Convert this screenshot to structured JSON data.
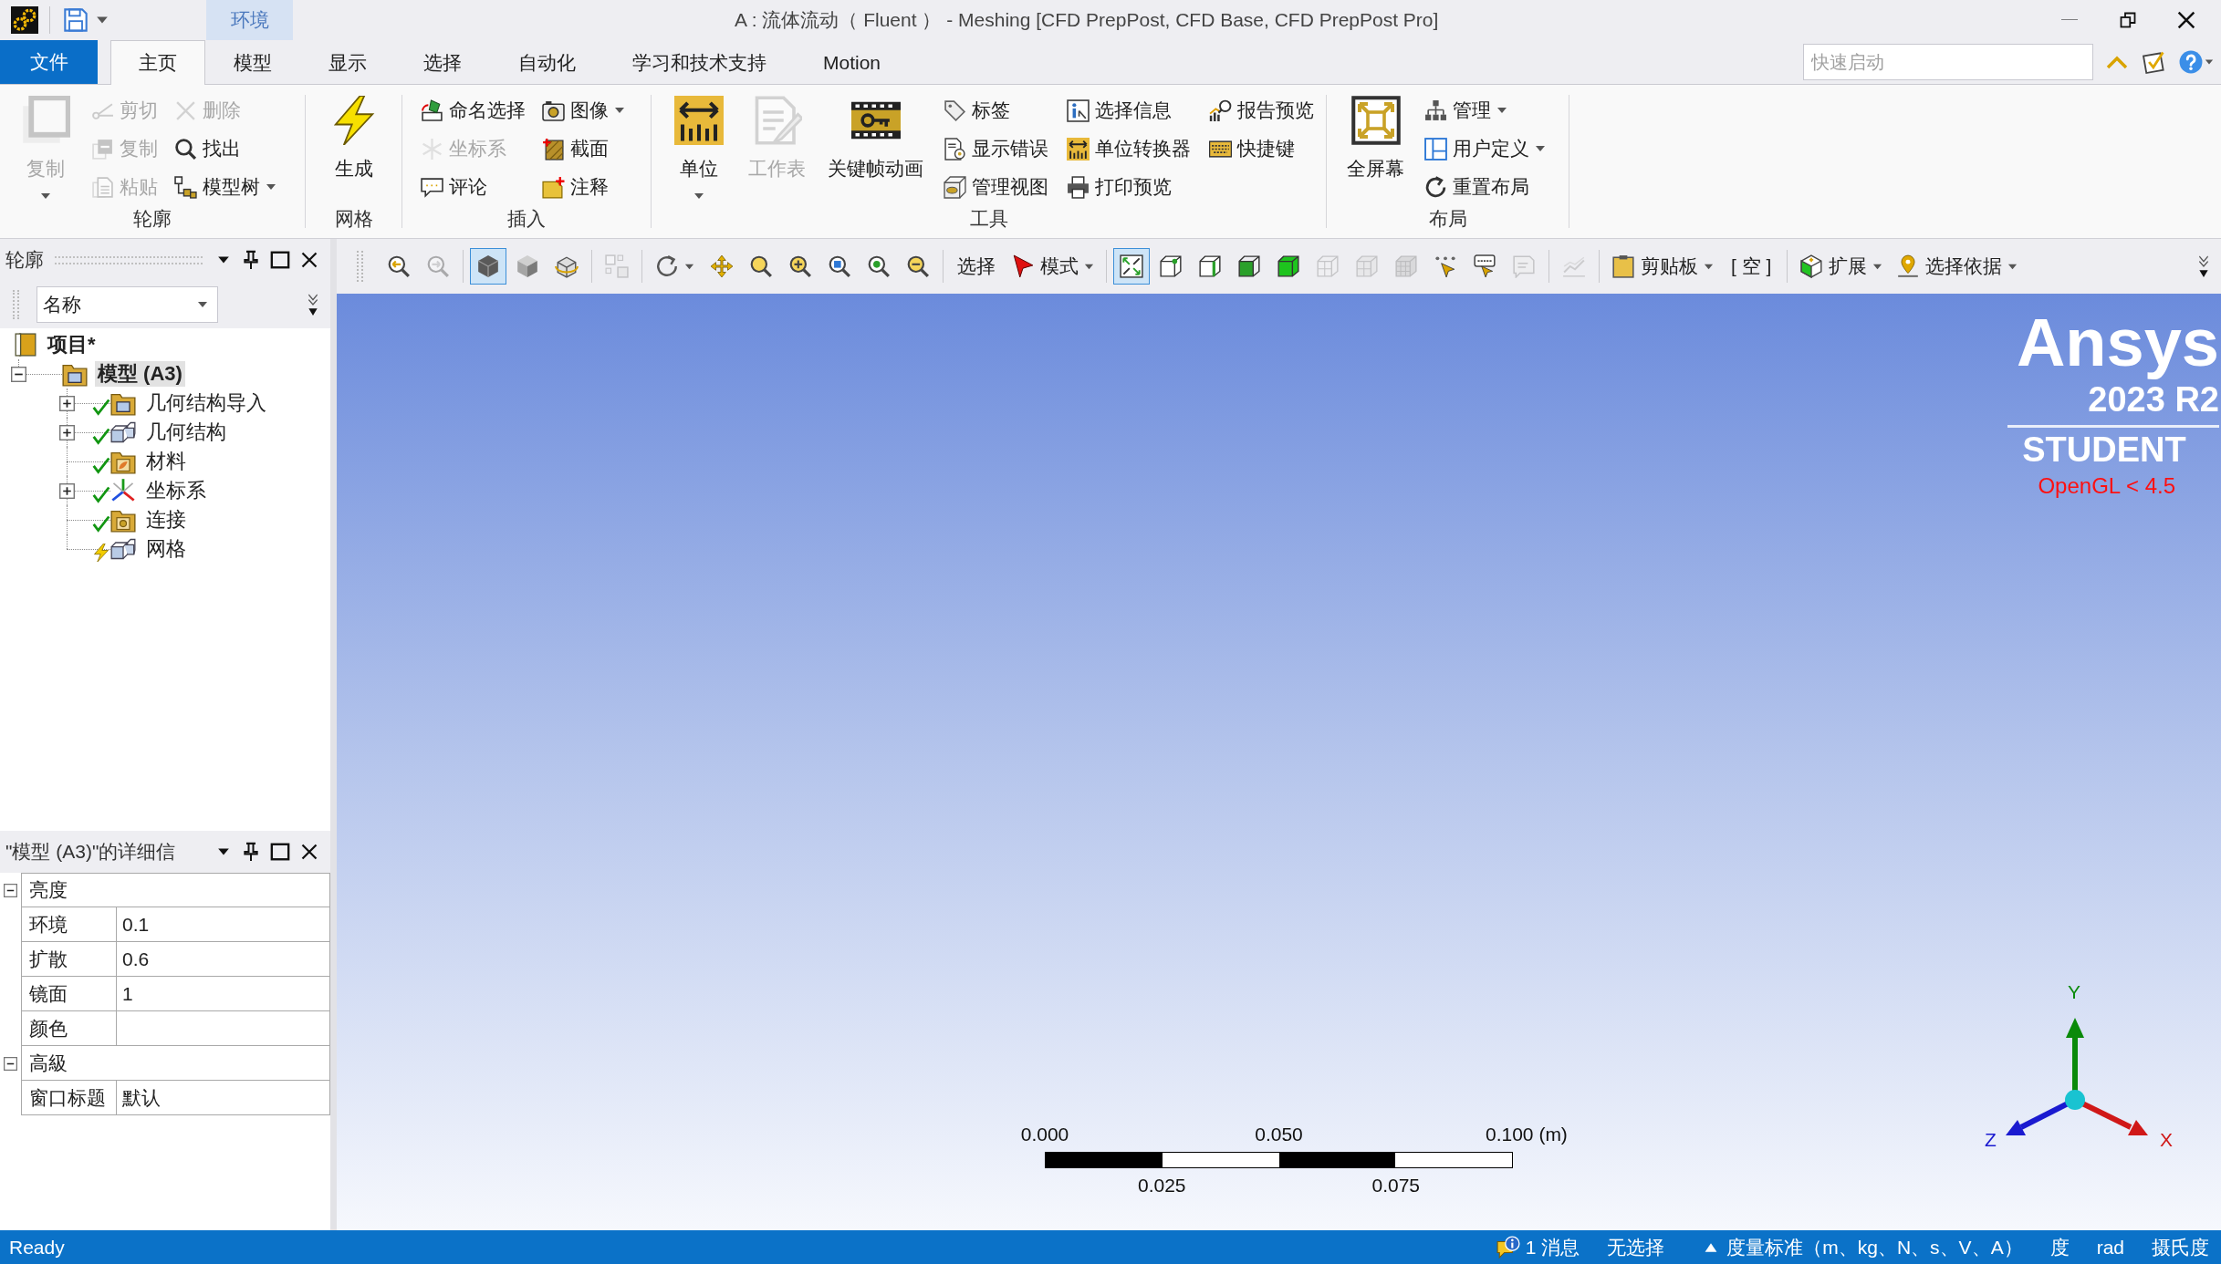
{
  "window": {
    "title": "A : 流体流动（ Fluent ） - Meshing [CFD PrepPost, CFD Base, CFD PrepPost Pro]",
    "context_tab": "环境"
  },
  "menu_tabs": [
    {
      "label": "文件",
      "kind": "file",
      "selected": false
    },
    {
      "label": "主页",
      "kind": "tab",
      "selected": true
    },
    {
      "label": "模型",
      "kind": "tab",
      "selected": false
    },
    {
      "label": "显示",
      "kind": "tab",
      "selected": false
    },
    {
      "label": "选择",
      "kind": "tab",
      "selected": false
    },
    {
      "label": "自动化",
      "kind": "tab",
      "selected": false
    },
    {
      "label": "学习和技术支持",
      "kind": "tab",
      "selected": false
    },
    {
      "label": "Motion",
      "kind": "tab",
      "selected": false
    }
  ],
  "quick_launch": {
    "placeholder": "快速启动"
  },
  "ribbon": [
    {
      "label": "轮廓",
      "columns": [
        {
          "kind": "large",
          "label": "复制",
          "disabled": true,
          "dropdown": true
        },
        {
          "kind": "stack",
          "items": [
            {
              "label": "剪切",
              "disabled": true
            },
            {
              "label": "复制",
              "disabled": true
            },
            {
              "label": "粘贴",
              "disabled": true
            }
          ]
        },
        {
          "kind": "stack",
          "items": [
            {
              "label": "删除",
              "disabled": true
            },
            {
              "label": "找出",
              "disabled": false
            },
            {
              "label": "模型树",
              "disabled": false,
              "dropdown": true
            }
          ]
        }
      ]
    },
    {
      "label": "网格",
      "columns": [
        {
          "kind": "large",
          "label": "生成",
          "disabled": false
        }
      ]
    },
    {
      "label": "插入",
      "columns": [
        {
          "kind": "stack",
          "items": [
            {
              "label": "命名选择",
              "disabled": false
            },
            {
              "label": "坐标系",
              "disabled": true
            },
            {
              "label": "评论",
              "disabled": false
            }
          ]
        },
        {
          "kind": "stack",
          "items": [
            {
              "label": "图像",
              "disabled": false,
              "dropdown": true
            },
            {
              "label": "截面",
              "disabled": false
            },
            {
              "label": "注释",
              "disabled": false
            }
          ]
        }
      ]
    },
    {
      "label": "工具",
      "columns": [
        {
          "kind": "large",
          "label": "单位",
          "disabled": false,
          "dropdown": true
        },
        {
          "kind": "large",
          "label": "工作表",
          "disabled": true
        },
        {
          "kind": "large",
          "label": "关键帧动画",
          "disabled": false
        },
        {
          "kind": "stack",
          "items": [
            {
              "label": "标签",
              "disabled": false
            },
            {
              "label": "显示错误",
              "disabled": false
            },
            {
              "label": "管理视图",
              "disabled": false
            }
          ]
        },
        {
          "kind": "stack",
          "items": [
            {
              "label": "选择信息",
              "disabled": false
            },
            {
              "label": "单位转换器",
              "disabled": false
            },
            {
              "label": "打印预览",
              "disabled": false
            }
          ]
        },
        {
          "kind": "stack",
          "items": [
            {
              "label": "报告预览",
              "disabled": false
            },
            {
              "label": "快捷键",
              "disabled": false
            }
          ]
        }
      ]
    },
    {
      "label": "布局",
      "columns": [
        {
          "kind": "large",
          "label": "全屏幕",
          "disabled": false
        },
        {
          "kind": "stack",
          "items": [
            {
              "label": "管理",
              "disabled": false,
              "dropdown": true
            },
            {
              "label": "用户定义",
              "disabled": false,
              "dropdown": true
            },
            {
              "label": "重置布局",
              "disabled": false
            }
          ]
        }
      ]
    }
  ],
  "toolbar": {
    "groups": [
      [
        {
          "kind": "icon",
          "selected": false,
          "disabled": false
        },
        {
          "kind": "icon",
          "selected": false,
          "disabled": true
        }
      ],
      [
        {
          "kind": "icon",
          "selected": true,
          "disabled": false
        },
        {
          "kind": "icon",
          "selected": false,
          "disabled": false
        },
        {
          "kind": "icon",
          "selected": false,
          "disabled": false
        }
      ],
      [
        {
          "kind": "icon",
          "selected": false,
          "disabled": true
        }
      ],
      [
        {
          "kind": "icon_menu",
          "selected": false,
          "disabled": false
        },
        {
          "kind": "icon",
          "selected": false,
          "disabled": false
        },
        {
          "kind": "icon",
          "selected": false,
          "disabled": false
        },
        {
          "kind": "icon",
          "selected": false,
          "disabled": false
        },
        {
          "kind": "icon",
          "selected": false,
          "disabled": false
        },
        {
          "kind": "icon",
          "selected": false,
          "disabled": false
        },
        {
          "kind": "icon",
          "selected": false,
          "disabled": false
        }
      ],
      [
        {
          "kind": "button",
          "label": "选择"
        },
        {
          "kind": "menu",
          "label": "模式"
        }
      ],
      [
        {
          "kind": "icon",
          "selected": true,
          "disabled": false
        },
        {
          "kind": "icon",
          "selected": false,
          "disabled": false
        },
        {
          "kind": "icon",
          "selected": false,
          "disabled": false
        },
        {
          "kind": "icon",
          "selected": false,
          "disabled": false
        },
        {
          "kind": "icon",
          "selected": false,
          "disabled": false
        },
        {
          "kind": "icon",
          "selected": false,
          "disabled": true
        },
        {
          "kind": "icon",
          "selected": false,
          "disabled": true
        },
        {
          "kind": "icon",
          "selected": false,
          "disabled": true
        },
        {
          "kind": "icon",
          "selected": false,
          "disabled": false
        },
        {
          "kind": "icon",
          "selected": false,
          "disabled": false
        },
        {
          "kind": "icon",
          "selected": false,
          "disabled": true
        }
      ],
      [
        {
          "kind": "icon",
          "selected": false,
          "disabled": true
        }
      ],
      [
        {
          "kind": "menu",
          "label": "剪贴板"
        },
        {
          "kind": "label",
          "label": "[ 空 ]"
        }
      ],
      [
        {
          "kind": "menu",
          "label": "扩展"
        },
        {
          "kind": "menu",
          "label": "选择依据"
        }
      ]
    ]
  },
  "outline": {
    "title": "轮廓",
    "filter": {
      "value": "名称"
    },
    "tree": [
      {
        "label": "项目*",
        "selected": false,
        "children": [
          {
            "label": "模型 (A3)",
            "selected": true,
            "expanded": true,
            "children": [
              {
                "label": "几何结构导入",
                "complete": true,
                "expanded": false,
                "selected": false
              },
              {
                "label": "几何结构",
                "complete": true,
                "expanded": false,
                "selected": false
              },
              {
                "label": "材料",
                "complete": true,
                "selected": false
              },
              {
                "label": "坐标系",
                "complete": true,
                "expanded": false,
                "selected": false
              },
              {
                "label": "连接",
                "complete": true,
                "selected": false
              },
              {
                "label": "网格",
                "complete": false,
                "selected": false
              }
            ]
          }
        ]
      }
    ]
  },
  "details": {
    "title": "\"模型 (A3)\"的详细信",
    "sections": [
      {
        "label": "亮度",
        "expanded": true,
        "rows": [
          {
            "name": "环境",
            "value": "0.1"
          },
          {
            "name": "扩散",
            "value": "0.6"
          },
          {
            "name": "镜面",
            "value": "1"
          },
          {
            "name": "颜色"
          }
        ]
      },
      {
        "label": "高級",
        "expanded": true,
        "rows": [
          {
            "name": "窗口标题",
            "value": "默认"
          }
        ]
      }
    ]
  },
  "viewport": {
    "logo": {
      "name": "Ansys",
      "version": "2023 R2",
      "edition": "STUDENT"
    },
    "renderer_note": "OpenGL < 4.5",
    "scale_bar": {
      "top_labels": [
        "0.000",
        "0.050",
        "0.100 (m)"
      ],
      "bottom_labels": [
        "0.025",
        "0.075"
      ]
    },
    "triad": {
      "axes": [
        {
          "label": "Y",
          "color": "#0a8a0a"
        },
        {
          "label": "Z",
          "color": "#1a1ad0"
        },
        {
          "label": "X",
          "color": "#d01818"
        }
      ]
    }
  },
  "status_bar": {
    "status": "Ready",
    "items": [
      {
        "kind": "messages",
        "label": "1 消息"
      },
      {
        "kind": "text",
        "label": "无选择"
      },
      {
        "kind": "menu",
        "label": "度量标准（m、kg、N、s、V、A）"
      },
      {
        "kind": "text",
        "label": "度"
      },
      {
        "kind": "text",
        "label": "rad"
      },
      {
        "kind": "text",
        "label": "摄氏度"
      }
    ]
  }
}
